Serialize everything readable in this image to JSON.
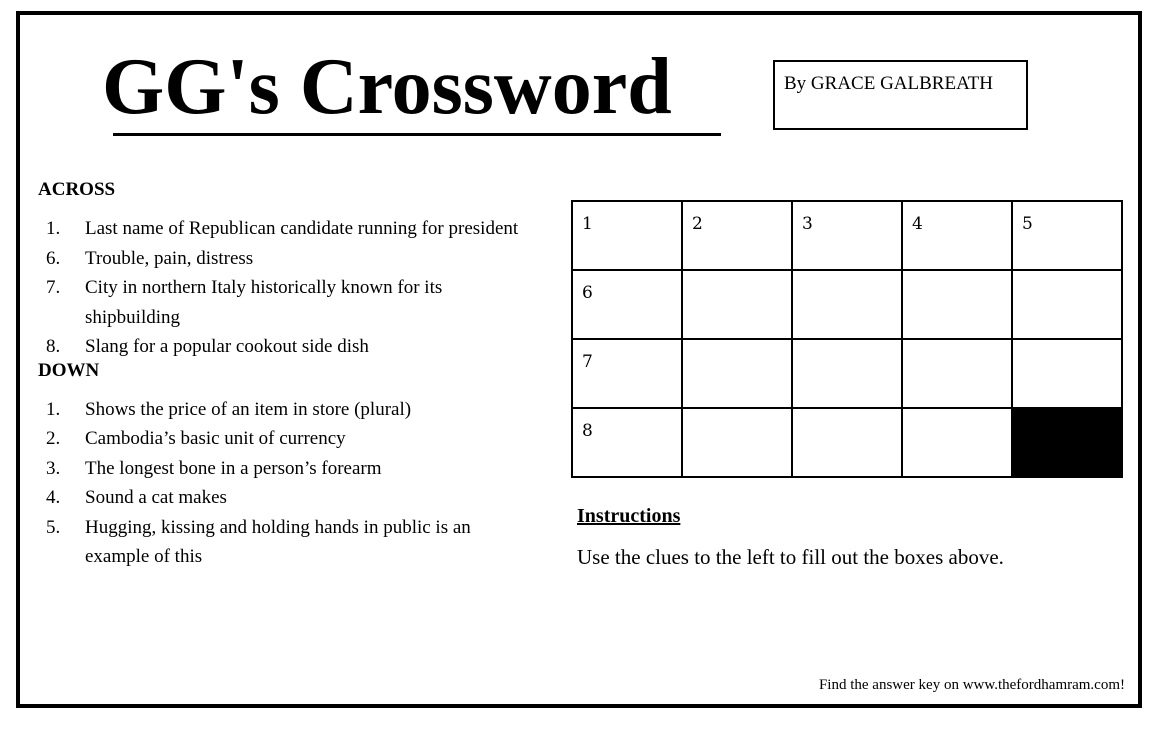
{
  "header": {
    "title": "GG's Crossword",
    "byline": "By GRACE GALBREATH"
  },
  "across": {
    "heading": "ACROSS",
    "clues": [
      {
        "num": "1.",
        "text": "Last name of Republican candidate running for president"
      },
      {
        "num": "6.",
        "text": "Trouble, pain, distress"
      },
      {
        "num": "7.",
        "text": "City in northern Italy historically known for its shipbuilding"
      },
      {
        "num": "8.",
        "text": "Slang for a popular cookout side dish"
      }
    ]
  },
  "down": {
    "heading": "DOWN",
    "clues": [
      {
        "num": "1.",
        "text": "Shows the price of an item in store (plural)"
      },
      {
        "num": "2.",
        "text": "Cambodia’s basic unit of currency"
      },
      {
        "num": "3.",
        "text": "The longest bone in a person’s forearm"
      },
      {
        "num": "4.",
        "text": "Sound a cat makes"
      },
      {
        "num": "5.",
        "text": "Hugging, kissing and holding hands in public is an example of this"
      }
    ]
  },
  "grid": {
    "rows": [
      [
        {
          "num": "1",
          "black": false
        },
        {
          "num": "2",
          "black": false
        },
        {
          "num": "3",
          "black": false
        },
        {
          "num": "4",
          "black": false
        },
        {
          "num": "5",
          "black": false
        }
      ],
      [
        {
          "num": "6",
          "black": false
        },
        {
          "num": "",
          "black": false
        },
        {
          "num": "",
          "black": false
        },
        {
          "num": "",
          "black": false
        },
        {
          "num": "",
          "black": false
        }
      ],
      [
        {
          "num": "7",
          "black": false
        },
        {
          "num": "",
          "black": false
        },
        {
          "num": "",
          "black": false
        },
        {
          "num": "",
          "black": false
        },
        {
          "num": "",
          "black": false
        }
      ],
      [
        {
          "num": "8",
          "black": false
        },
        {
          "num": "",
          "black": false
        },
        {
          "num": "",
          "black": false
        },
        {
          "num": "",
          "black": false
        },
        {
          "num": "",
          "black": true
        }
      ]
    ]
  },
  "instructions": {
    "heading": "Instructions",
    "text": "Use the clues to the left to fill out the boxes above."
  },
  "footer": {
    "text": "Find the answer key on www.thefordhamram.com!"
  }
}
